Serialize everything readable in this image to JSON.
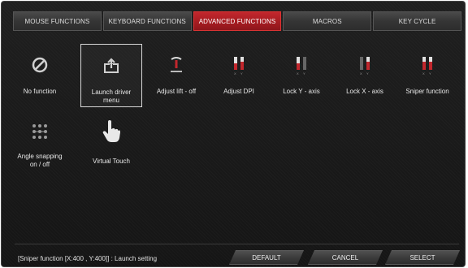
{
  "tabs": [
    {
      "label": "MOUSE FUNCTIONS"
    },
    {
      "label": "KEYBOARD FUNCTIONS"
    },
    {
      "label": "ADVANCED FUNCTIONS"
    },
    {
      "label": "MACROS"
    },
    {
      "label": "KEY CYCLE"
    }
  ],
  "active_tab": "ADVANCED FUNCTIONS",
  "functions": [
    {
      "label": "No function",
      "icon": "no-function-icon"
    },
    {
      "label": "Launch driver menu",
      "icon": "launch-driver-icon"
    },
    {
      "label": "Adjust lift - off",
      "icon": "lift-off-icon"
    },
    {
      "label": "Adjust DPI",
      "icon": "dpi-icon"
    },
    {
      "label": "Lock Y - axis",
      "icon": "lock-y-axis-icon"
    },
    {
      "label": "Lock X - axis",
      "icon": "lock-x-axis-icon"
    },
    {
      "label": "Sniper function",
      "icon": "sniper-icon"
    },
    {
      "label": "Angle snapping on / off",
      "icon": "angle-snapping-icon"
    },
    {
      "label": "Virtual Touch",
      "icon": "hand-pointer-icon"
    }
  ],
  "selected_function": "Launch driver menu",
  "status_text": "[Sniper function [X:400 , Y:400]] : Launch setting",
  "buttons": {
    "default": "DEFAULT",
    "cancel": "CANCEL",
    "select": "SELECT"
  },
  "colors": {
    "accent": "#c2272d",
    "background": "#1b1b1b"
  }
}
